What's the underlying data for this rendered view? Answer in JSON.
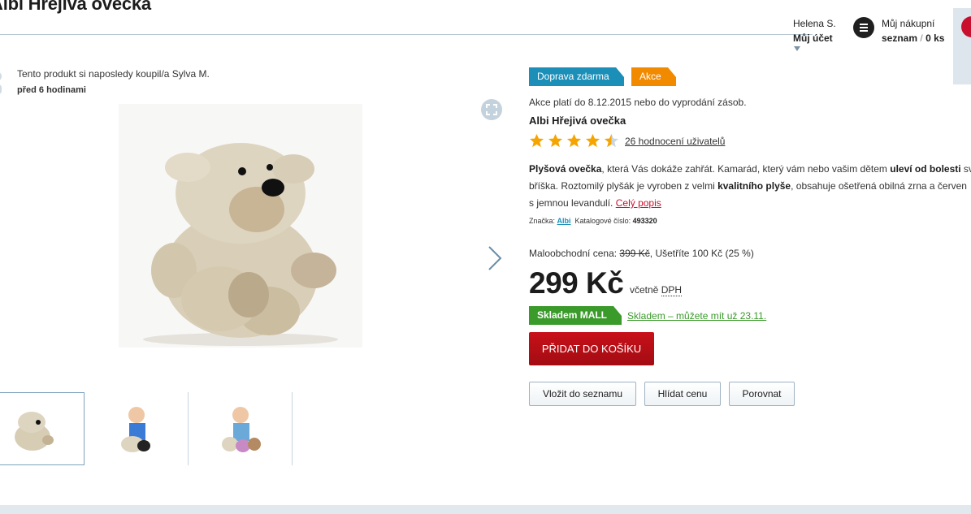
{
  "product": {
    "title": "Albi Hřejivá ovečka",
    "name": "Albi Hřejivá ovečka",
    "rating_value": 4.5,
    "rating_max": 5,
    "rating_link": "26 hodnocení uživatelů"
  },
  "header": {
    "user_name": "Helena S.",
    "account_label": "Můj účet",
    "list_line1": "Můj nákupní",
    "list_word": "seznam",
    "list_sep": "/",
    "list_count": "0 ks"
  },
  "recent_purchase": {
    "line1": "Tento produkt si naposledy koupil/a Sylva M.",
    "line2": "před 6 hodinami"
  },
  "tags": {
    "free_shipping": "Doprava zdarma",
    "sale": "Akce"
  },
  "promo_note": "Akce platí do 8.12.2015 nebo do vyprodání zásob.",
  "description": {
    "l1_b1": "Plyšová ovečka",
    "l1_t1": ", která Vás dokáže zahřát. Kamarád, který vám nebo vašim dětem ",
    "l1_b2": "uleví od bolesti",
    "l1_t2": " sv",
    "l2_t1": "bříška. Roztomilý plyšák je vyroben z velmi ",
    "l2_b1": "kvalitního plyše",
    "l2_t2": ", obsahuje ošetřená obilná zrna a červen",
    "l3_t1": "s jemnou levandulí. ",
    "more": "Celý popis"
  },
  "meta": {
    "brand_label": "Značka:",
    "brand": "Albi",
    "catalog_label": "Katalogové číslo:",
    "catalog": "493320"
  },
  "pricing": {
    "retail_label": "Maloobchodní cena:",
    "retail_price": "399 Kč",
    "savings": ", Ušetříte 100 Kč (25 %)",
    "price": "299 Kč",
    "vat_prefix": "včetně",
    "vat": "DPH"
  },
  "stock": {
    "tag": "Skladem MALL",
    "link": "Skladem – můžete mít už 23.11."
  },
  "actions": {
    "add_to_cart": "PŘIDAT DO KOŠÍKU",
    "add_to_list": "Vložit do seznamu",
    "watch_price": "Hlídat cenu",
    "compare": "Porovnat"
  },
  "colors": {
    "accent_red": "#c8102e",
    "tag_blue": "#1b8fb8",
    "tag_orange": "#f28a00",
    "stock_green": "#3a9a2a",
    "star": "#f5a400"
  }
}
